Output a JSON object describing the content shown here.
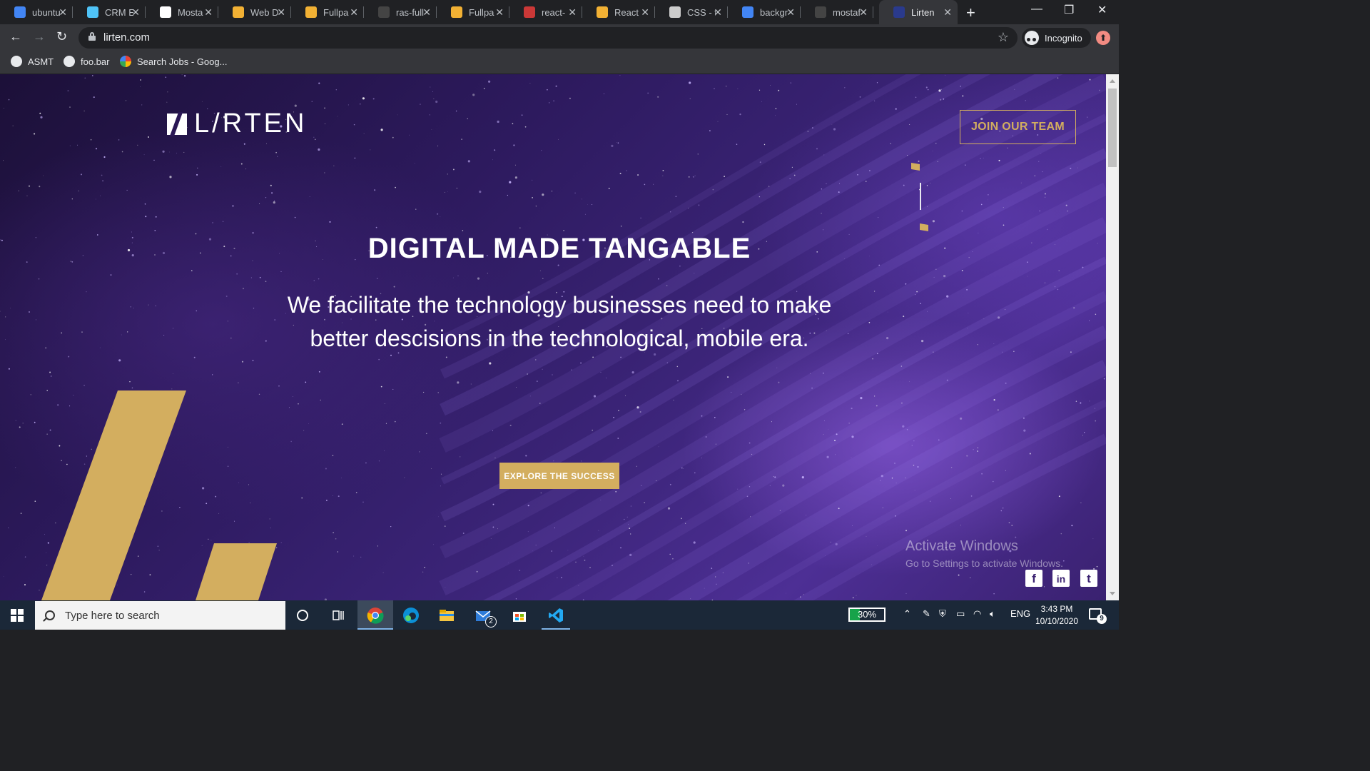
{
  "browser": {
    "tabs": [
      {
        "title": "ubuntu",
        "icon": "chrome-remote-icon",
        "color": "#4285f4"
      },
      {
        "title": "CRM E",
        "icon": "crm-icon",
        "color": "#4fc3f7"
      },
      {
        "title": "Mosta",
        "icon": "medium-icon",
        "color": "#ffffff"
      },
      {
        "title": "Web D",
        "icon": "bulb-icon",
        "color": "#f2b134"
      },
      {
        "title": "Fullpa",
        "icon": "bulb-icon",
        "color": "#f2b134"
      },
      {
        "title": "ras-full",
        "icon": "github-icon",
        "color": "#444444"
      },
      {
        "title": "Fullpa",
        "icon": "bulb-icon",
        "color": "#f2b134"
      },
      {
        "title": "react-",
        "icon": "npm-icon",
        "color": "#cb3837"
      },
      {
        "title": "React",
        "icon": "bulb-icon",
        "color": "#f2b134"
      },
      {
        "title": "CSS - t",
        "icon": "codepen-icon",
        "color": "#cccccc"
      },
      {
        "title": "backgr",
        "icon": "google-icon",
        "color": "#4285f4"
      },
      {
        "title": "mostaf",
        "icon": "github-icon",
        "color": "#444444"
      },
      {
        "title": "Lirten",
        "icon": "lirten-icon",
        "color": "#2a3a8c",
        "active": true
      }
    ],
    "url": "lirten.com",
    "incognito_label": "Incognito",
    "update_badge": "⬆"
  },
  "bookmarks": [
    {
      "label": "ASMT",
      "icon": "globe-icon"
    },
    {
      "label": "foo.bar",
      "icon": "globe-icon"
    },
    {
      "label": "Search Jobs - Goog...",
      "icon": "google-icon"
    }
  ],
  "page": {
    "logo_text": "L/RTEN",
    "join_button": "JOIN OUR TEAM",
    "headline": "DIGITAL MADE TANGABLE",
    "subline": "We facilitate the technology businesses need to make better descisions in the technological, mobile era.",
    "cta": "EXPLORE THE SUCCESS",
    "accent_color": "#d3ae5f",
    "social": [
      {
        "label": "f",
        "icon": "facebook-icon"
      },
      {
        "label": "in",
        "icon": "linkedin-icon"
      },
      {
        "label": "t",
        "icon": "twitter-icon"
      }
    ]
  },
  "watermark": {
    "title": "Activate Windows",
    "subtitle": "Go to Settings to activate Windows."
  },
  "taskbar": {
    "search_placeholder": "Type here to search",
    "mail_badge": "2",
    "battery": "30%",
    "battery_fraction": 0.3,
    "language": "ENG",
    "time": "3:43 PM",
    "date": "10/10/2020",
    "notifications": "9"
  }
}
